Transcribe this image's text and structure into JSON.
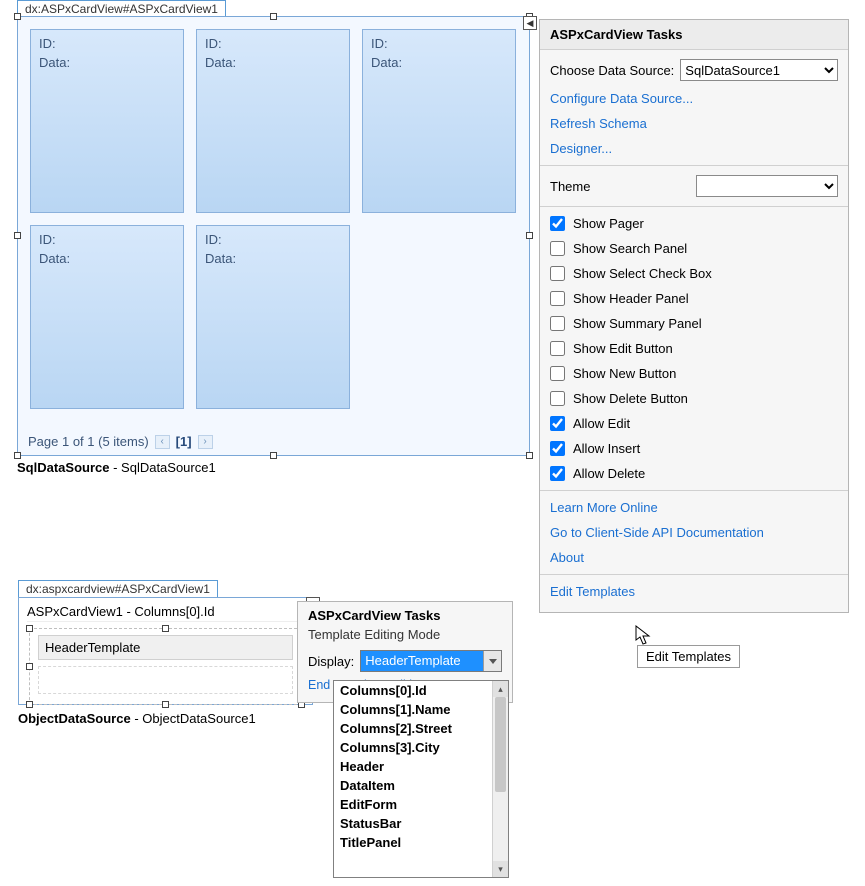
{
  "top": {
    "tag_tab": "dx:ASPxCardView#ASPxCardView1",
    "card_labels": {
      "id": "ID:",
      "data": "Data:"
    },
    "pager": {
      "text": "Page 1 of 1 (5 items)",
      "prev": "‹",
      "next": "›",
      "current": "[1]"
    },
    "smart_tag": "◀",
    "source_line_bold": "SqlDataSource",
    "source_line_rest": " - SqlDataSource1"
  },
  "tasks": {
    "title": "ASPxCardView Tasks",
    "choose_label": "Choose Data Source:",
    "choose_value": "SqlDataSource1",
    "links": {
      "configure": "Configure Data Source...",
      "refresh": "Refresh Schema",
      "designer": "Designer...",
      "learn": "Learn More Online",
      "api": "Go to Client-Side API Documentation",
      "about": "About",
      "edit_templates": "Edit Templates"
    },
    "theme_label": "Theme",
    "theme_value": "",
    "checks": [
      {
        "label": "Show Pager",
        "checked": true
      },
      {
        "label": "Show Search Panel",
        "checked": false
      },
      {
        "label": "Show Select Check Box",
        "checked": false
      },
      {
        "label": "Show Header Panel",
        "checked": false
      },
      {
        "label": "Show Summary Panel",
        "checked": false
      },
      {
        "label": "Show Edit Button",
        "checked": false
      },
      {
        "label": "Show New Button",
        "checked": false
      },
      {
        "label": "Show Delete Button",
        "checked": false
      },
      {
        "label": "Allow Edit",
        "checked": true
      },
      {
        "label": "Allow Insert",
        "checked": true
      },
      {
        "label": "Allow Delete",
        "checked": true
      }
    ]
  },
  "bottom": {
    "tag_tab": "dx:aspxcardview#ASPxCardView1",
    "breadcrumb": "ASPxCardView1 - Columns[0].Id",
    "header_template_label": "HeaderTemplate",
    "smart_tag": "◀",
    "source_line_bold": "ObjectDataSource",
    "source_line_rest": " - ObjectDataSource1"
  },
  "tmpl": {
    "title": "ASPxCardView Tasks",
    "mode": "Template Editing Mode",
    "display_label": "Display:",
    "display_value": "HeaderTemplate",
    "end_link": "End Template Editing"
  },
  "dropdown": {
    "items": [
      "Columns[0].Id",
      "Columns[1].Name",
      "Columns[2].Street",
      "Columns[3].City",
      "Header",
      "DataItem",
      "EditForm",
      "StatusBar",
      "TitlePanel"
    ]
  },
  "tooltip": "Edit Templates"
}
